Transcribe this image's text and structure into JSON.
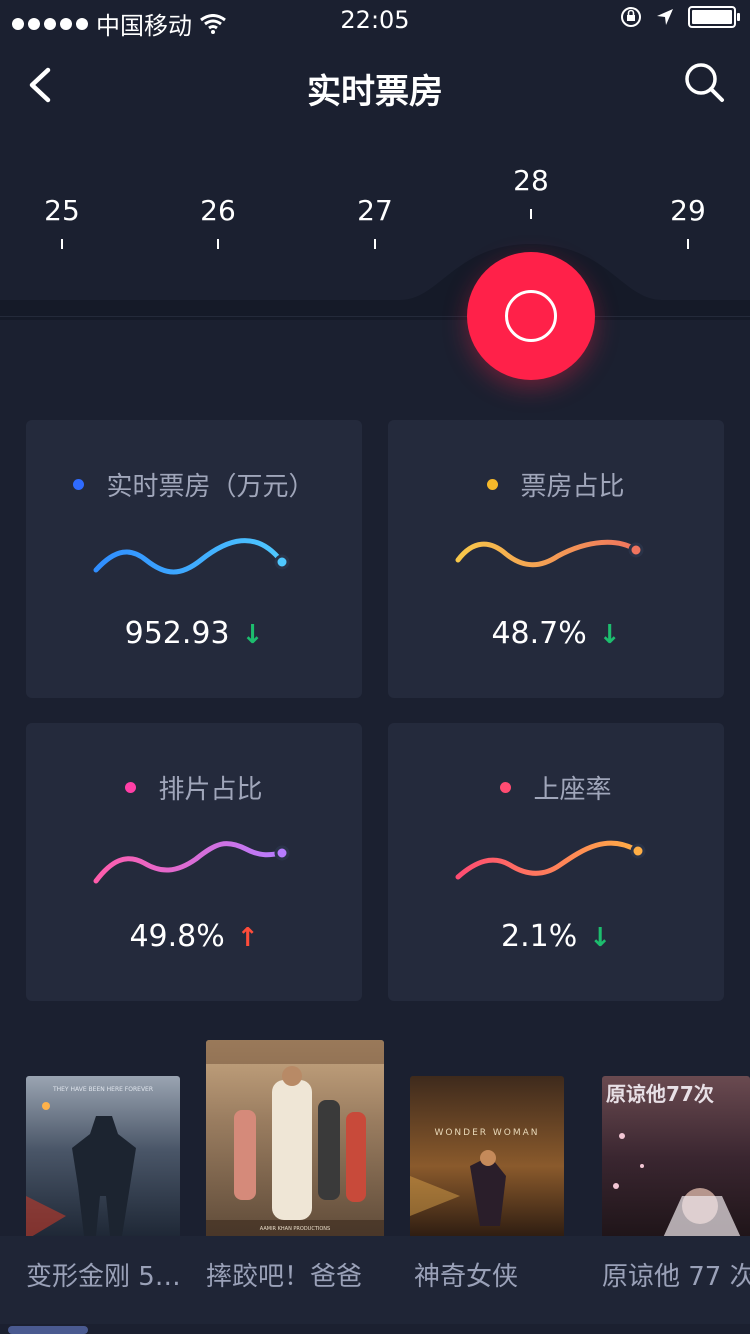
{
  "status": {
    "carrier": "中国移动",
    "time": "22:05"
  },
  "nav": {
    "title": "实时票房"
  },
  "dates": [
    "25",
    "26",
    "27",
    "28",
    "29"
  ],
  "selected_date": "28",
  "cards": [
    {
      "label": "实时票房（万元）",
      "value": "952.93",
      "trend": "down",
      "dot_color": "#2f6bff",
      "line_start": "#2f8dff",
      "line_end": "#4fc8ff"
    },
    {
      "label": "票房占比",
      "value": "48.7%",
      "trend": "down",
      "dot_color": "#f5b82a",
      "line_start": "#f8c84a",
      "line_end": "#f0745e"
    },
    {
      "label": "排片占比",
      "value": "49.8%",
      "trend": "up",
      "dot_color": "#ff3fa6",
      "line_start": "#ff5cab",
      "line_end": "#b77cff"
    },
    {
      "label": "上座率",
      "value": "2.1%",
      "trend": "down",
      "dot_color": "#ff4c72",
      "line_start": "#ff4c72",
      "line_end": "#ffae45"
    }
  ],
  "movies": [
    {
      "title": "变形金刚 5…",
      "poster_color": "#36435a"
    },
    {
      "title": "摔跤吧！爸爸",
      "poster_color": "#8a6a4c"
    },
    {
      "title": "神奇女侠",
      "poster_color": "#6a4a2e"
    },
    {
      "title": "原谅他 77 次",
      "poster_color": "#4a2a34"
    }
  ],
  "poster_texts": {
    "m1_tagline": "THEY HAVE BEEN HERE FOREVER",
    "m3_logo": "WONDER WOMAN",
    "m4_logo": "原谅他77次",
    "m2_footer": "AAMIR KHAN PRODUCTIONS"
  }
}
